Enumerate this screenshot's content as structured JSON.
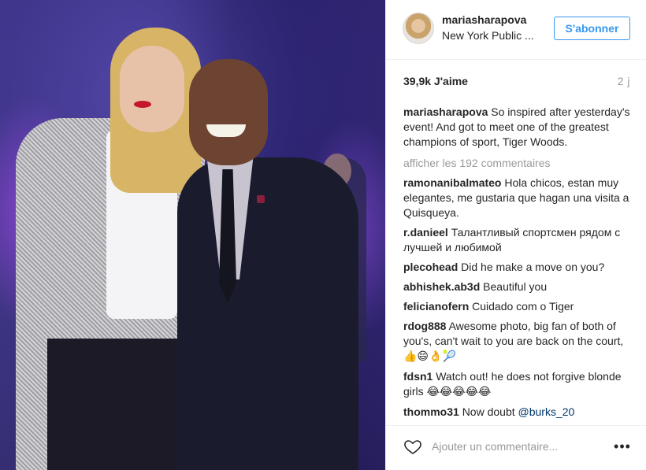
{
  "header": {
    "username": "mariasharapova",
    "location": "New York Public ...",
    "follow_label": "S'abonner"
  },
  "post": {
    "likes": "39,9k J'aime",
    "time_ago": "2 j"
  },
  "caption": {
    "user": "mariasharapova",
    "text": "So inspired after yesterday's event! And got to meet one of the greatest champions of sport, Tiger Woods."
  },
  "load_more_label": "afficher les 192 commentaires",
  "comments": [
    {
      "user": "ramonanibalmateo",
      "text": "Hola chicos, estan muy elegantes, me gustaria que hagan una visita a Quisqueya."
    },
    {
      "user": "r.danieel",
      "text": "Талантливый спортсмен рядом с лучшей и любимой"
    },
    {
      "user": "plecohead",
      "text": "Did he make a move on you?"
    },
    {
      "user": "abhishek.ab3d",
      "text": "Beautiful you"
    },
    {
      "user": "felicianofern",
      "text": "Cuidado com o Tiger"
    },
    {
      "user": "rdog888",
      "text": "Awesome photo, big fan of both of you's, can't wait to you are back on the court,",
      "emoji": "👍😄👌🎾"
    },
    {
      "user": "fdsn1",
      "text": "Watch out! he does not forgive blonde girls",
      "emoji": "😂😂😂😂😂"
    },
    {
      "user": "thommo31",
      "text": "Now doubt",
      "mention": "@burks_20"
    }
  ],
  "footer": {
    "comment_placeholder": "Ajouter un commentaire...",
    "more_label": "•••"
  },
  "icons": {
    "heart": "heart-outline-icon",
    "more": "more-options-icon"
  },
  "colors": {
    "accent": "#3897f0",
    "secondary_text": "#999999"
  }
}
